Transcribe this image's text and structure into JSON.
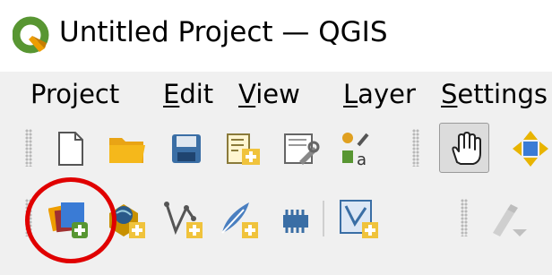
{
  "window": {
    "title": "Untitled Project — QGIS",
    "app_icon": "qgis-logo-icon"
  },
  "menu": {
    "items": [
      {
        "label": "Project",
        "mnemonic_index": null
      },
      {
        "label": "Edit",
        "mnemonic_index": 0
      },
      {
        "label": "View",
        "mnemonic_index": 0
      },
      {
        "label": "Layer",
        "mnemonic_index": 0
      },
      {
        "label": "Settings",
        "mnemonic_index": 0
      }
    ],
    "p0": "Project",
    "e_m": "E",
    "e_r": "dit",
    "v_m": "V",
    "v_r": "iew",
    "l_m": "L",
    "l_r": "ayer",
    "s_m": "S",
    "s_r": "ettings"
  },
  "toolbar_project": {
    "icons": [
      "new-project-icon",
      "open-project-icon",
      "save-project-icon",
      "new-print-layout-icon",
      "layout-manager-icon",
      "style-manager-icon",
      "pan-map-icon",
      "pan-to-selection-icon"
    ]
  },
  "toolbar_data_source": {
    "icons": [
      "data-source-manager-icon",
      "new-geopackage-layer-icon",
      "new-shapefile-layer-icon",
      "new-spatialite-layer-icon",
      "new-virtual-layer-icon",
      "new-temporary-scratch-layer-icon",
      "digitize-icon"
    ]
  },
  "annotation": {
    "highlight_color": "#e00000",
    "highlighted": "data-source-manager-icon"
  },
  "colors": {
    "qgis_green": "#589632",
    "qgis_yellow": "#ee9d00",
    "folder_yellow": "#f5b81b",
    "save_blue": "#3a6ea5"
  }
}
